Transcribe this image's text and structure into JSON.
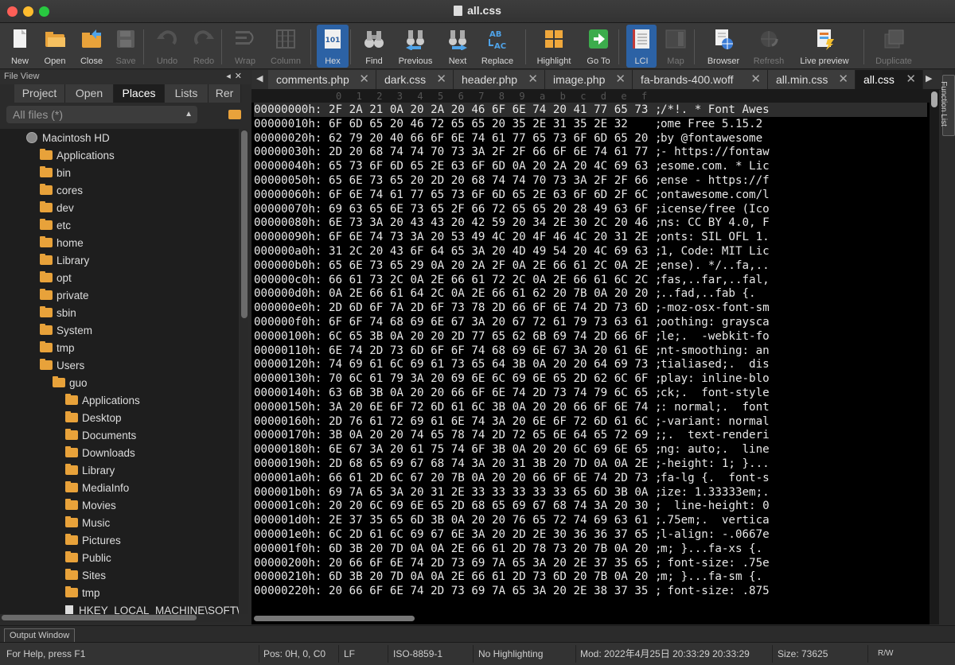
{
  "window": {
    "title": "all.css"
  },
  "toolbar": {
    "buttons": [
      {
        "label": "New",
        "icon": "new-document-icon",
        "enabled": true
      },
      {
        "label": "Open",
        "icon": "open-folder-icon",
        "enabled": true
      },
      {
        "label": "Close",
        "icon": "close-folder-icon",
        "enabled": true
      },
      {
        "label": "Save",
        "icon": "save-disk-icon",
        "enabled": false
      },
      {
        "label": "Undo",
        "icon": "undo-icon",
        "enabled": false
      },
      {
        "label": "Redo",
        "icon": "redo-icon",
        "enabled": false
      },
      {
        "label": "Wrap",
        "icon": "wrap-icon",
        "enabled": false
      },
      {
        "label": "Column",
        "icon": "column-icon",
        "enabled": false
      },
      {
        "label": "Hex",
        "icon": "hex-icon",
        "enabled": true,
        "active": true
      },
      {
        "label": "Find",
        "icon": "binoculars-icon",
        "enabled": true
      },
      {
        "label": "Previous",
        "icon": "binoculars-previous-icon",
        "enabled": true
      },
      {
        "label": "Next",
        "icon": "binoculars-next-icon",
        "enabled": true
      },
      {
        "label": "Replace",
        "icon": "replace-icon",
        "enabled": true
      },
      {
        "label": "Highlight",
        "icon": "highlight-grid-icon",
        "enabled": true
      },
      {
        "label": "Go To",
        "icon": "go-to-arrow-icon",
        "enabled": true
      },
      {
        "label": "LCI",
        "icon": "lci-icon",
        "enabled": true,
        "active": true
      },
      {
        "label": "Map",
        "icon": "map-icon",
        "enabled": false
      },
      {
        "label": "Browser",
        "icon": "browser-icon",
        "enabled": true
      },
      {
        "label": "Refresh",
        "icon": "refresh-globe-icon",
        "enabled": false
      },
      {
        "label": "Live preview",
        "icon": "live-preview-icon",
        "enabled": true
      },
      {
        "label": "Duplicate",
        "icon": "duplicate-icon",
        "enabled": false
      }
    ]
  },
  "file_view": {
    "title": "File View",
    "tabs": [
      "Project",
      "Open",
      "Places",
      "Lists",
      "Rer"
    ],
    "selected_tab": "Places",
    "filter": "All files (*)",
    "tree": [
      {
        "label": "Macintosh HD",
        "depth": 0,
        "type": "disk"
      },
      {
        "label": "Applications",
        "depth": 1,
        "type": "folder"
      },
      {
        "label": "bin",
        "depth": 1,
        "type": "folder"
      },
      {
        "label": "cores",
        "depth": 1,
        "type": "folder"
      },
      {
        "label": "dev",
        "depth": 1,
        "type": "folder"
      },
      {
        "label": "etc",
        "depth": 1,
        "type": "folder"
      },
      {
        "label": "home",
        "depth": 1,
        "type": "folder"
      },
      {
        "label": "Library",
        "depth": 1,
        "type": "folder"
      },
      {
        "label": "opt",
        "depth": 1,
        "type": "folder"
      },
      {
        "label": "private",
        "depth": 1,
        "type": "folder"
      },
      {
        "label": "sbin",
        "depth": 1,
        "type": "folder"
      },
      {
        "label": "System",
        "depth": 1,
        "type": "folder"
      },
      {
        "label": "tmp",
        "depth": 1,
        "type": "folder"
      },
      {
        "label": "Users",
        "depth": 1,
        "type": "folder"
      },
      {
        "label": "guo",
        "depth": 2,
        "type": "folder"
      },
      {
        "label": "Applications",
        "depth": 3,
        "type": "folder"
      },
      {
        "label": "Desktop",
        "depth": 3,
        "type": "folder"
      },
      {
        "label": "Documents",
        "depth": 3,
        "type": "folder"
      },
      {
        "label": "Downloads",
        "depth": 3,
        "type": "folder"
      },
      {
        "label": "Library",
        "depth": 3,
        "type": "folder"
      },
      {
        "label": "MediaInfo",
        "depth": 3,
        "type": "folder"
      },
      {
        "label": "Movies",
        "depth": 3,
        "type": "folder"
      },
      {
        "label": "Music",
        "depth": 3,
        "type": "folder"
      },
      {
        "label": "Pictures",
        "depth": 3,
        "type": "folder"
      },
      {
        "label": "Public",
        "depth": 3,
        "type": "folder"
      },
      {
        "label": "Sites",
        "depth": 3,
        "type": "folder"
      },
      {
        "label": "tmp",
        "depth": 3,
        "type": "folder"
      },
      {
        "label": "HKEY_LOCAL_MACHINE\\SOFTWA",
        "depth": 3,
        "type": "file"
      }
    ]
  },
  "editor_tabs": [
    {
      "label": "comments.php",
      "selected": false
    },
    {
      "label": "dark.css",
      "selected": false
    },
    {
      "label": "header.php",
      "selected": false
    },
    {
      "label": "image.php",
      "selected": false
    },
    {
      "label": "fa-brands-400.woff",
      "selected": false
    },
    {
      "label": "all.min.css",
      "selected": false
    },
    {
      "label": "all.css",
      "selected": true
    }
  ],
  "function_list_label": "Function List",
  "hex": {
    "ruler": [
      "0",
      "1",
      "2",
      "3",
      "4",
      "5",
      "6",
      "7",
      "8",
      "9",
      "a",
      "b",
      "c",
      "d",
      "e",
      "f"
    ],
    "current_line": 0,
    "lines": [
      {
        "addr": "00000000h:",
        "bytes": "2F 2A 21 0A 20 2A 20 46 6F 6E 74 20 41 77 65 73",
        "ascii": "/*!. * Font Awes"
      },
      {
        "addr": "00000010h:",
        "bytes": "6F 6D 65 20 46 72 65 65 20 35 2E 31 35 2E 32",
        "ascii": "ome Free 5.15.2"
      },
      {
        "addr": "00000020h:",
        "bytes": "62 79 20 40 66 6F 6E 74 61 77 65 73 6F 6D 65 20",
        "ascii": "by @fontawesome"
      },
      {
        "addr": "00000030h:",
        "bytes": "2D 20 68 74 74 70 73 3A 2F 2F 66 6F 6E 74 61 77",
        "ascii": "- https://fontaw"
      },
      {
        "addr": "00000040h:",
        "bytes": "65 73 6F 6D 65 2E 63 6F 6D 0A 20 2A 20 4C 69 63",
        "ascii": "esome.com. * Lic"
      },
      {
        "addr": "00000050h:",
        "bytes": "65 6E 73 65 20 2D 20 68 74 74 70 73 3A 2F 2F 66",
        "ascii": "ense - https://f"
      },
      {
        "addr": "00000060h:",
        "bytes": "6F 6E 74 61 77 65 73 6F 6D 65 2E 63 6F 6D 2F 6C",
        "ascii": "ontawesome.com/l"
      },
      {
        "addr": "00000070h:",
        "bytes": "69 63 65 6E 73 65 2F 66 72 65 65 20 28 49 63 6F",
        "ascii": "icense/free (Ico"
      },
      {
        "addr": "00000080h:",
        "bytes": "6E 73 3A 20 43 43 20 42 59 20 34 2E 30 2C 20 46",
        "ascii": "ns: CC BY 4.0, F"
      },
      {
        "addr": "00000090h:",
        "bytes": "6F 6E 74 73 3A 20 53 49 4C 20 4F 46 4C 20 31 2E",
        "ascii": "onts: SIL OFL 1."
      },
      {
        "addr": "000000a0h:",
        "bytes": "31 2C 20 43 6F 64 65 3A 20 4D 49 54 20 4C 69 63",
        "ascii": "1, Code: MIT Lic"
      },
      {
        "addr": "000000b0h:",
        "bytes": "65 6E 73 65 29 0A 20 2A 2F 0A 2E 66 61 2C 0A 2E",
        "ascii": "ense). */..fa,.."
      },
      {
        "addr": "000000c0h:",
        "bytes": "66 61 73 2C 0A 2E 66 61 72 2C 0A 2E 66 61 6C 2C",
        "ascii": "fas,..far,..fal,"
      },
      {
        "addr": "000000d0h:",
        "bytes": "0A 2E 66 61 64 2C 0A 2E 66 61 62 20 7B 0A 20 20",
        "ascii": "..fad,..fab {."
      },
      {
        "addr": "000000e0h:",
        "bytes": "2D 6D 6F 7A 2D 6F 73 78 2D 66 6F 6E 74 2D 73 6D",
        "ascii": "-moz-osx-font-sm"
      },
      {
        "addr": "000000f0h:",
        "bytes": "6F 6F 74 68 69 6E 67 3A 20 67 72 61 79 73 63 61",
        "ascii": "oothing: graysca"
      },
      {
        "addr": "00000100h:",
        "bytes": "6C 65 3B 0A 20 20 2D 77 65 62 6B 69 74 2D 66 6F",
        "ascii": "le;.  -webkit-fo"
      },
      {
        "addr": "00000110h:",
        "bytes": "6E 74 2D 73 6D 6F 6F 74 68 69 6E 67 3A 20 61 6E",
        "ascii": "nt-smoothing: an"
      },
      {
        "addr": "00000120h:",
        "bytes": "74 69 61 6C 69 61 73 65 64 3B 0A 20 20 64 69 73",
        "ascii": "tialiased;.  dis"
      },
      {
        "addr": "00000130h:",
        "bytes": "70 6C 61 79 3A 20 69 6E 6C 69 6E 65 2D 62 6C 6F",
        "ascii": "play: inline-blo"
      },
      {
        "addr": "00000140h:",
        "bytes": "63 6B 3B 0A 20 20 66 6F 6E 74 2D 73 74 79 6C 65",
        "ascii": "ck;.  font-style"
      },
      {
        "addr": "00000150h:",
        "bytes": "3A 20 6E 6F 72 6D 61 6C 3B 0A 20 20 66 6F 6E 74",
        "ascii": ": normal;.  font"
      },
      {
        "addr": "00000160h:",
        "bytes": "2D 76 61 72 69 61 6E 74 3A 20 6E 6F 72 6D 61 6C",
        "ascii": "-variant: normal"
      },
      {
        "addr": "00000170h:",
        "bytes": "3B 0A 20 20 74 65 78 74 2D 72 65 6E 64 65 72 69",
        "ascii": ";.  text-renderi"
      },
      {
        "addr": "00000180h:",
        "bytes": "6E 67 3A 20 61 75 74 6F 3B 0A 20 20 6C 69 6E 65",
        "ascii": "ng: auto;.  line"
      },
      {
        "addr": "00000190h:",
        "bytes": "2D 68 65 69 67 68 74 3A 20 31 3B 20 7D 0A 0A 2E",
        "ascii": "-height: 1; }..."
      },
      {
        "addr": "000001a0h:",
        "bytes": "66 61 2D 6C 67 20 7B 0A 20 20 66 6F 6E 74 2D 73",
        "ascii": "fa-lg {.  font-s"
      },
      {
        "addr": "000001b0h:",
        "bytes": "69 7A 65 3A 20 31 2E 33 33 33 33 33 65 6D 3B 0A",
        "ascii": "ize: 1.33333em;."
      },
      {
        "addr": "000001c0h:",
        "bytes": "20 20 6C 69 6E 65 2D 68 65 69 67 68 74 3A 20 30",
        "ascii": "  line-height: 0"
      },
      {
        "addr": "000001d0h:",
        "bytes": "2E 37 35 65 6D 3B 0A 20 20 76 65 72 74 69 63 61",
        "ascii": ".75em;.  vertica"
      },
      {
        "addr": "000001e0h:",
        "bytes": "6C 2D 61 6C 69 67 6E 3A 20 2D 2E 30 36 36 37 65",
        "ascii": "l-align: -.0667e"
      },
      {
        "addr": "000001f0h:",
        "bytes": "6D 3B 20 7D 0A 0A 2E 66 61 2D 78 73 20 7B 0A 20",
        "ascii": "m; }...fa-xs {."
      },
      {
        "addr": "00000200h:",
        "bytes": "20 66 6F 6E 74 2D 73 69 7A 65 3A 20 2E 37 35 65",
        "ascii": " font-size: .75e"
      },
      {
        "addr": "00000210h:",
        "bytes": "6D 3B 20 7D 0A 0A 2E 66 61 2D 73 6D 20 7B 0A 20",
        "ascii": "m; }...fa-sm {."
      },
      {
        "addr": "00000220h:",
        "bytes": "20 66 6F 6E 74 2D 73 69 7A 65 3A 20 2E 38 37 35",
        "ascii": " font-size: .875"
      }
    ]
  },
  "output_window_label": "Output Window",
  "statusbar": {
    "help": "For Help, press F1",
    "pos": "Pos: 0H, 0, C0",
    "line_ending": "LF",
    "encoding": "ISO-8859-1",
    "highlighting": "No Highlighting",
    "modified": "Mod: 2022年4月25日 20:33:29 20:33:29",
    "size": "Size: 73625",
    "mode": "R/W"
  }
}
